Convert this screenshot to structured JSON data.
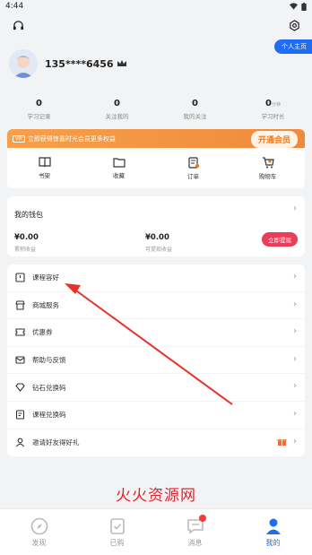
{
  "status_bar": {
    "time": "4:44"
  },
  "profile": {
    "username": "135****6456",
    "homepage_label": "个人主页"
  },
  "stats": [
    {
      "value": "0",
      "unit": "",
      "label": "学习记录"
    },
    {
      "value": "0",
      "unit": "",
      "label": "关注我的"
    },
    {
      "value": "0",
      "unit": "",
      "label": "我的关注"
    },
    {
      "value": "0",
      "unit": "分钟",
      "label": "学习时长"
    }
  ],
  "vip": {
    "tag": "VIP",
    "text": "立即获得惊喜时光会员更多权益",
    "button": "开通会员"
  },
  "quick_actions": [
    {
      "icon": "book-icon",
      "label": "书架"
    },
    {
      "icon": "folder-icon",
      "label": "收藏"
    },
    {
      "icon": "order-icon",
      "label": "订单"
    },
    {
      "icon": "cart-icon",
      "label": "购物车"
    }
  ],
  "wallet": {
    "title": "我的钱包",
    "balance_amount": "¥0.00",
    "balance_label": "累积收益",
    "withdrawable_amount": "¥0.00",
    "withdrawable_label": "可提现收益",
    "withdraw_button": "立即提现"
  },
  "menu": [
    {
      "icon": "course-icon",
      "label": "课程容好"
    },
    {
      "icon": "shop-icon",
      "label": "商城服务"
    },
    {
      "icon": "coupon-icon",
      "label": "优惠券"
    },
    {
      "icon": "mail-icon",
      "label": "帮助与反馈"
    },
    {
      "icon": "diamond-icon",
      "label": "钻石兑换码"
    },
    {
      "icon": "redeem-icon",
      "label": "课程兑换码"
    },
    {
      "icon": "user-invite-icon",
      "label": "邀请好友得好礼"
    }
  ],
  "watermark": "火火资源网",
  "nav": [
    {
      "icon": "compass-icon",
      "label": "发现"
    },
    {
      "icon": "purchased-icon",
      "label": "已购"
    },
    {
      "icon": "message-icon",
      "label": "消息"
    },
    {
      "icon": "person-icon",
      "label": "我的"
    }
  ],
  "colors": {
    "accent": "#1f6cf5",
    "vip": "#f08a3a",
    "withdraw": "#ef3b5a",
    "arrow": "#e8322d"
  }
}
